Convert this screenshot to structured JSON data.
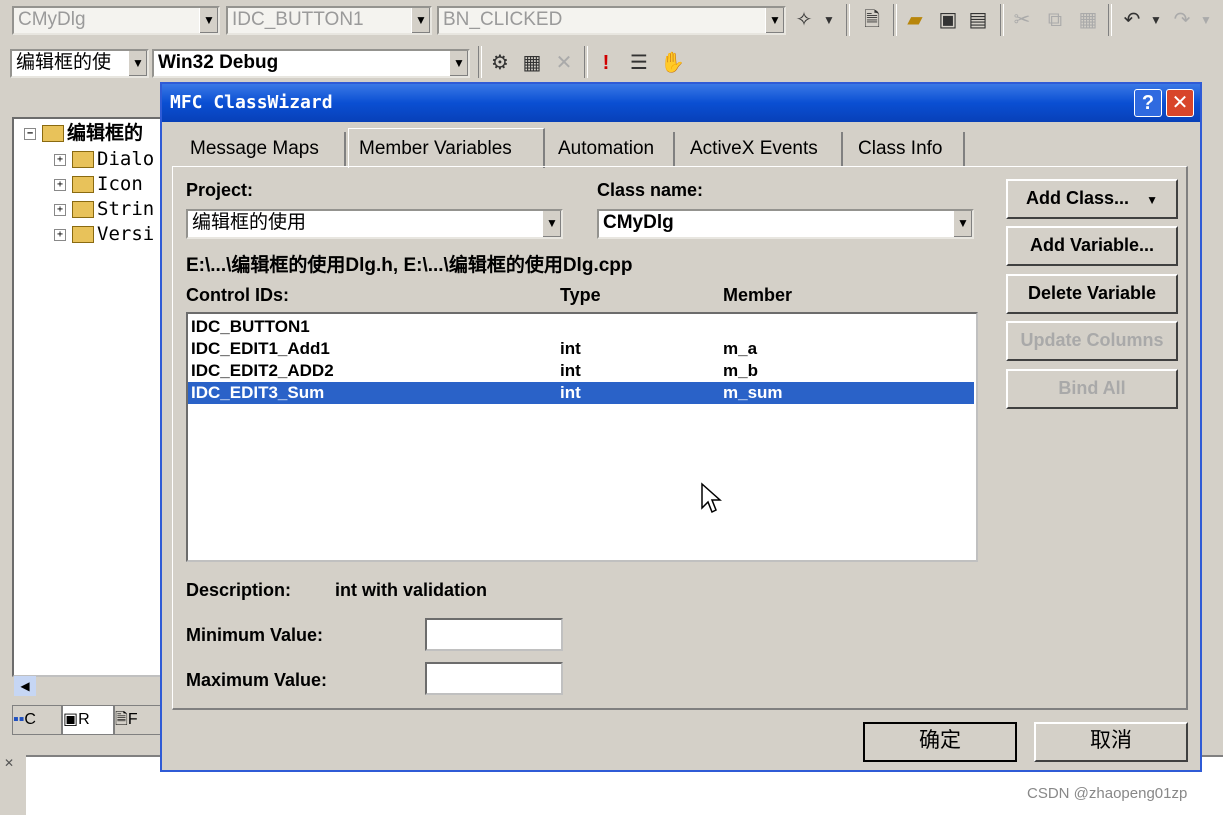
{
  "toolbar1": {
    "class_combo": "CMyDlg",
    "id_combo": "IDC_BUTTON1",
    "msg_combo": "BN_CLICKED",
    "icons": [
      "wizard-wand-icon",
      "new-text-file-icon",
      "open-folder-icon",
      "save-icon",
      "save-all-icon",
      "cut-icon",
      "copy-icon",
      "paste-icon",
      "undo-icon",
      "redo-icon"
    ]
  },
  "toolbar2": {
    "project_combo": "编辑框的使",
    "config_combo": "Win32 Debug",
    "icons": [
      "compile-icon",
      "build-icon",
      "stop-build-icon",
      "execute-icon",
      "insert-breakpoint-icon",
      "hand-icon"
    ]
  },
  "tree": {
    "root": "编辑框的",
    "items": [
      "Dialo",
      "Icon",
      "Strin",
      "Versi"
    ],
    "tabs": [
      "C",
      "R",
      "F"
    ]
  },
  "dialog": {
    "title": "MFC ClassWizard",
    "help": "?",
    "close": "✕",
    "tabs": [
      "Message Maps",
      "Member Variables",
      "Automation",
      "ActiveX Events",
      "Class Info"
    ],
    "project_label": "Project:",
    "project_value": "编辑框的使用",
    "classname_label": "Class name:",
    "classname_value": "CMyDlg",
    "files": "E:\\...\\编辑框的使用Dlg.h, E:\\...\\编辑框的使用Dlg.cpp",
    "col_ids": "Control IDs:",
    "col_type": "Type",
    "col_member": "Member",
    "rows": [
      {
        "id": "IDC_BUTTON1",
        "type": "",
        "member": ""
      },
      {
        "id": "IDC_EDIT1_Add1",
        "type": "int",
        "member": "m_a"
      },
      {
        "id": "IDC_EDIT2_ADD2",
        "type": "int",
        "member": "m_b"
      },
      {
        "id": "IDC_EDIT3_Sum",
        "type": "int",
        "member": "m_sum"
      }
    ],
    "buttons": [
      "Add Class...",
      "Add Variable...",
      "Delete Variable",
      "Update Columns",
      "Bind All"
    ],
    "description_label": "Description:",
    "description_value": "int with validation",
    "min_label": "Minimum Value:",
    "max_label": "Maximum Value:",
    "min_value": "",
    "max_value": "",
    "ok": "确定",
    "cancel": "取消"
  },
  "watermark": "CSDN @zhaopeng01zp"
}
